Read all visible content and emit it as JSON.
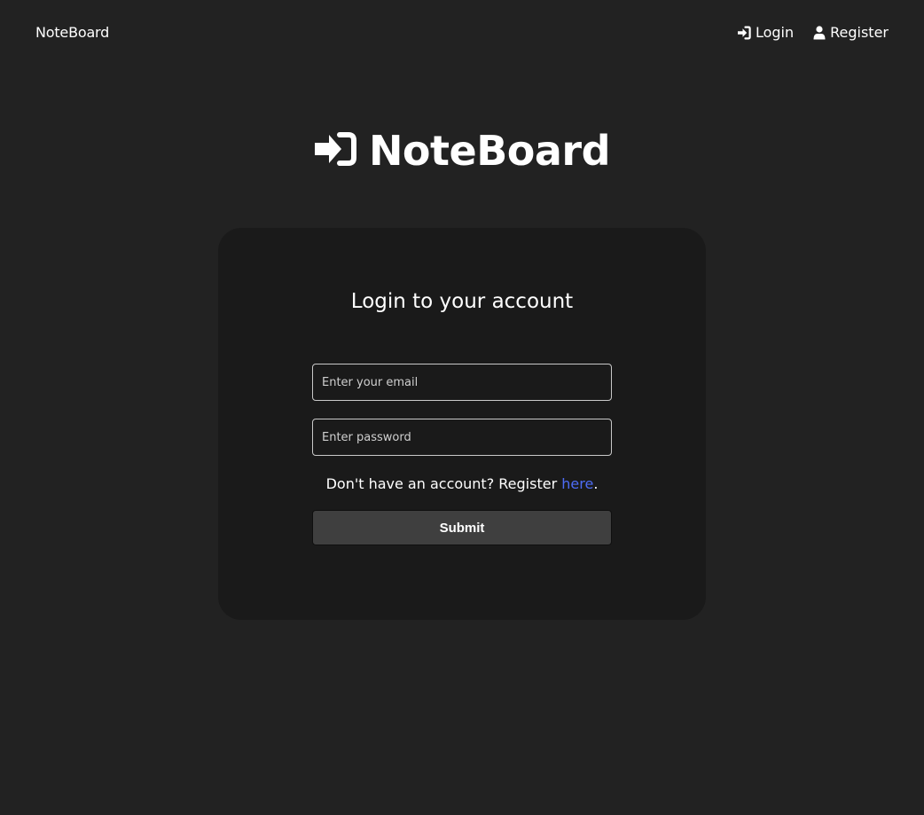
{
  "header": {
    "brand": "NoteBoard",
    "nav": [
      {
        "icon": "login-icon",
        "label": "Login"
      },
      {
        "icon": "user-icon",
        "label": "Register"
      }
    ]
  },
  "hero": {
    "icon": "login-icon",
    "title": "NoteBoard"
  },
  "form": {
    "title": "Login to your account",
    "email_placeholder": "Enter your email",
    "password_placeholder": "Enter password",
    "register_prefix": "Don't have an account? Register ",
    "register_link": "here",
    "register_suffix": ".",
    "submit_label": "Submit"
  },
  "colors": {
    "background": "#222222",
    "card": "#1a1a1a",
    "link": "#4d6cf5",
    "button": "#3f3f3f"
  }
}
